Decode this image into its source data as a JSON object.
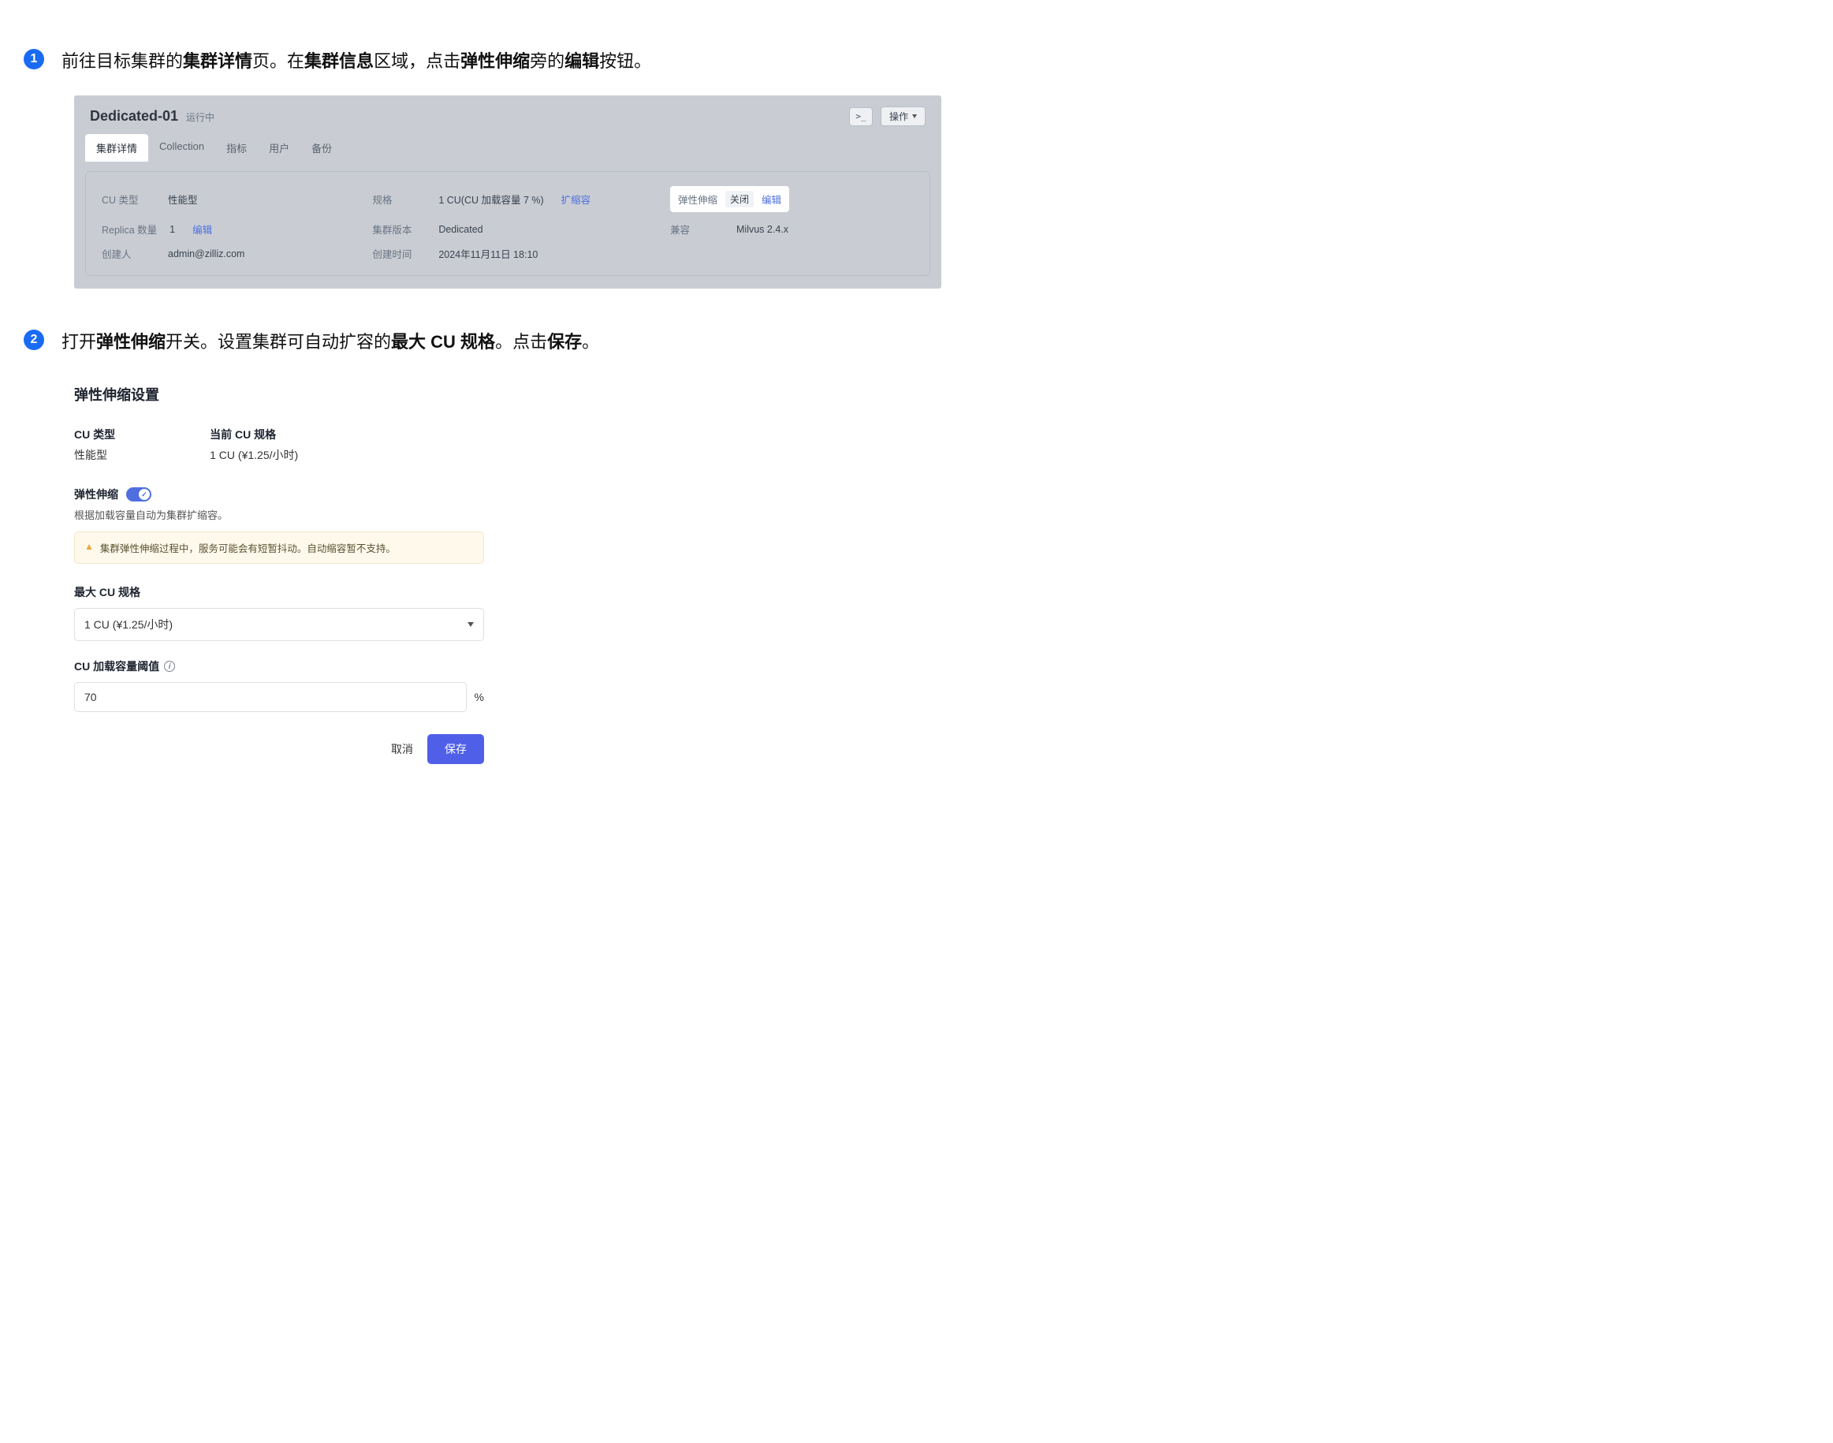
{
  "step1": {
    "num": "1",
    "text_parts": [
      "前往目标集群的",
      "集群详情",
      "页。在",
      "集群信息",
      "区域，点击",
      "弹性伸缩",
      "旁的",
      "编辑",
      "按钮。"
    ]
  },
  "cluster": {
    "title": "Dedicated-01",
    "status": "运行中",
    "cli_label": ">_",
    "ops_label": "操作",
    "tabs": [
      "集群详情",
      "Collection",
      "指标",
      "用户",
      "备份"
    ],
    "rows": [
      {
        "a_lbl": "CU 类型",
        "a_val": "性能型",
        "b_lbl": "规格",
        "b_val": "1 CU(CU 加载容量 7 %)",
        "b_link": "扩缩容",
        "c_auto_lbl": "弹性伸缩",
        "c_auto_pill": "关闭",
        "c_auto_edit": "编辑"
      },
      {
        "a_lbl": "Replica 数量",
        "a_val": "1",
        "a_link": "编辑",
        "b_lbl": "集群版本",
        "b_val": "Dedicated",
        "c_lbl": "兼容",
        "c_val": "Milvus 2.4.x"
      },
      {
        "a_lbl": "创建人",
        "a_val": "admin@zilliz.com",
        "b_lbl": "创建时间",
        "b_val": "2024年11月11日 18:10"
      }
    ]
  },
  "step2": {
    "num": "2",
    "text_parts": [
      "打开",
      "弹性伸缩",
      "开关。设置集群可自动扩容的",
      "最大 CU 规格",
      "。点击",
      "保存",
      "。"
    ]
  },
  "settings": {
    "title": "弹性伸缩设置",
    "cu_type_lbl": "CU 类型",
    "cu_type_val": "性能型",
    "cur_size_lbl": "当前 CU 规格",
    "cur_size_val": "1 CU (¥1.25/小时)",
    "toggle_lbl": "弹性伸缩",
    "toggle_desc": "根据加载容量自动为集群扩缩容。",
    "warn": "集群弹性伸缩过程中，服务可能会有短暂抖动。自动缩容暂不支持。",
    "max_lbl": "最大 CU 规格",
    "max_val": "1 CU (¥1.25/小时)",
    "thresh_lbl": "CU 加载容量阈值",
    "thresh_val": "70",
    "thresh_unit": "%",
    "cancel": "取消",
    "save": "保存"
  }
}
